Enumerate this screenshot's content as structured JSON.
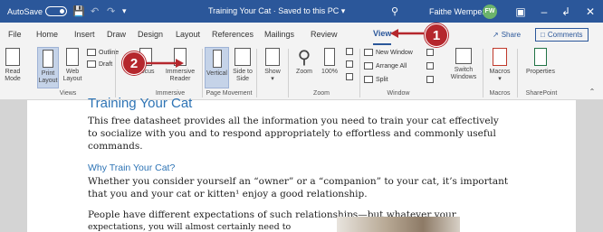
{
  "titlebar": {
    "autosave_label": "AutoSave",
    "autosave_state": "Off",
    "doc_title": "Training Your Cat · Saved to this PC ▾",
    "user_name": "Faithe Wempen",
    "user_initials": "FW"
  },
  "tabs": [
    "File",
    "Home",
    "Insert",
    "Draw",
    "Design",
    "Layout",
    "References",
    "Mailings",
    "Review",
    "View"
  ],
  "active_tab": "View",
  "share_label": "Share",
  "comments_label": "Comments",
  "ribbon": {
    "views": {
      "read_mode": "Read Mode",
      "print_layout": "Print Layout",
      "web_layout": "Web Layout",
      "outline": "Outline",
      "draft": "Draft",
      "group_label": "Views"
    },
    "immersive": {
      "focus": "Focus",
      "immersive_reader": "Immersive Reader",
      "group_label": "Immersive"
    },
    "page_movement": {
      "vertical": "Vertical",
      "side_to_side": "Side to Side",
      "group_label": "Page Movement"
    },
    "show": {
      "label": "Show"
    },
    "zoom": {
      "zoom": "Zoom",
      "hundred": "100%",
      "group_label": "Zoom"
    },
    "window": {
      "new_window": "New Window",
      "arrange_all": "Arrange All",
      "split": "Split",
      "switch_windows": "Switch Windows",
      "group_label": "Window"
    },
    "macros": {
      "label": "Macros",
      "group_label": "Macros"
    },
    "sharepoint": {
      "properties": "Properties",
      "group_label": "SharePoint"
    }
  },
  "document": {
    "title": "Training Your Cat",
    "para1_line1": "This free datasheet provides all the information you need to train your cat effectively",
    "para1_line2": "to socialize with you and to respond appropriately to effortless and commonly useful",
    "para1_line3": "commands.",
    "heading2": "Why Train Your Cat?",
    "para2_line1": "Whether you consider yourself an “owner” or a “companion” to your cat, it’s important",
    "para2_line2": "that you and your cat or kitten¹ enjoy a good relationship.",
    "para3_line1": "People have different expectations of such relationships—but whatever your",
    "para3_line2": "expectations, you will almost certainly need to"
  },
  "callouts": {
    "one": "1",
    "two": "2"
  },
  "colors": {
    "titlebar": "#2b579a",
    "callout": "#b5272d",
    "heading": "#2e74b5"
  }
}
